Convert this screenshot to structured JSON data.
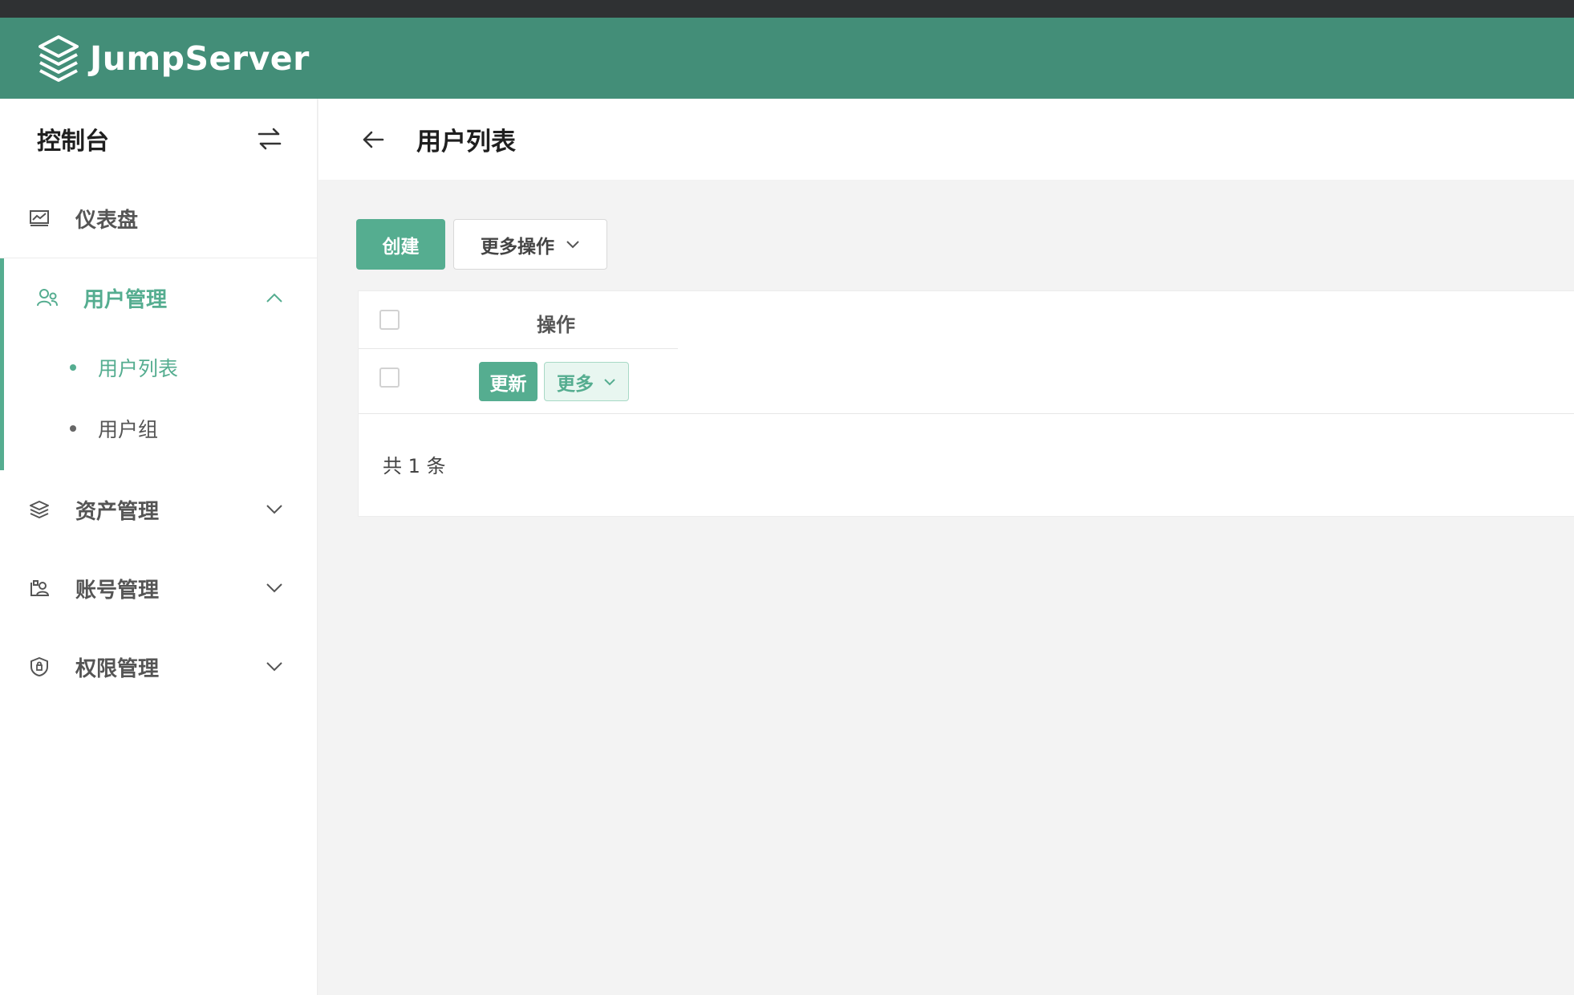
{
  "header": {
    "brand": "JumpServer"
  },
  "sidebar": {
    "title": "控制台",
    "items": [
      {
        "label": "仪表盘",
        "icon": "dashboard-icon"
      },
      {
        "label": "用户管理",
        "icon": "users-icon",
        "expanded": true,
        "children": [
          {
            "label": "用户列表",
            "active": true
          },
          {
            "label": "用户组",
            "active": false
          }
        ]
      },
      {
        "label": "资产管理",
        "icon": "layers-icon"
      },
      {
        "label": "账号管理",
        "icon": "account-icon"
      },
      {
        "label": "权限管理",
        "icon": "shield-icon"
      }
    ]
  },
  "page": {
    "title": "用户列表"
  },
  "toolbar": {
    "create_label": "创建",
    "more_actions_label": "更多操作"
  },
  "table": {
    "columns": [
      "操作"
    ],
    "rows": [
      {
        "update_label": "更新",
        "more_label": "更多"
      }
    ],
    "total_text": "共 1 条"
  },
  "colors": {
    "brand_header": "#438e78",
    "accent": "#55ad90",
    "top_strip": "#2f3133"
  }
}
